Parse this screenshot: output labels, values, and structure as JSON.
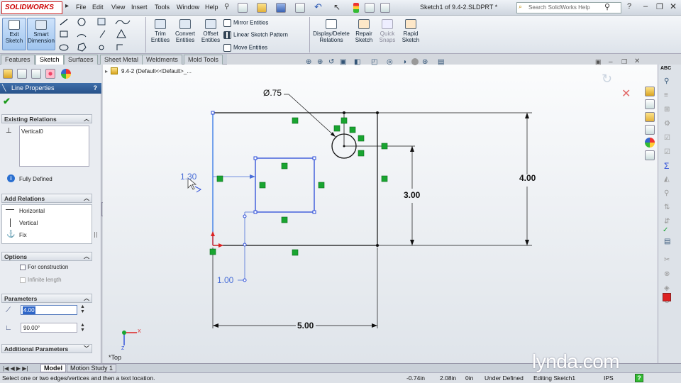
{
  "app": {
    "logo": "SOLIDWORKS",
    "doc_title": "Sketch1 of 9.4-2.SLDPRT *"
  },
  "menu": [
    "File",
    "Edit",
    "View",
    "Insert",
    "Tools",
    "Window",
    "Help"
  ],
  "search": {
    "placeholder": "Search SolidWorks Help"
  },
  "cmd": {
    "exit_sketch": "Exit Sketch",
    "smart_dimension": "Smart Dimension",
    "trim_entities": "Trim Entities",
    "convert_entities": "Convert Entities",
    "offset_entities": "Offset Entities",
    "mirror_entities": "Mirror Entities",
    "linear_pattern": "Linear Sketch Pattern",
    "move_entities": "Move Entities",
    "display_relations": "Display/Delete Relations",
    "repair_sketch": "Repair Sketch",
    "quick_snaps": "Quick Snaps",
    "rapid_sketch": "Rapid Sketch"
  },
  "tabs": [
    "Features",
    "Sketch",
    "Surfaces",
    "Sheet Metal",
    "Weldments",
    "Mold Tools"
  ],
  "tree_path": "9.4-2  (Default<<Default>_...",
  "pm": {
    "title": "Line Properties",
    "help": "?",
    "existing_relations": "Existing Relations",
    "relation_item": "Vertical0",
    "fully_defined": "Fully Defined",
    "add_relations": "Add Relations",
    "horizontal": "Horizontal",
    "vertical": "Vertical",
    "fix": "Fix",
    "options": "Options",
    "for_construction": "For construction",
    "infinite_length": "Infinite length",
    "parameters": "Parameters",
    "length_value": "4.00",
    "angle_value": "90.00°",
    "additional_parameters": "Additional Parameters"
  },
  "dims": {
    "dia": "Ø.75",
    "d4": "4.00",
    "d3": "3.00",
    "d5": "5.00",
    "d130": "1.30",
    "d100": "1.00"
  },
  "view_label": "*Top",
  "bottom_tabs": [
    "Model",
    "Motion Study 1"
  ],
  "status": {
    "message": "Select one or two edges/vertices and then a text location.",
    "x": "-0.74in",
    "y": "2.08in",
    "z": "0in",
    "state": "Under Defined",
    "editing": "Editing Sketch1",
    "units": "IPS"
  },
  "watermark": "lynda.com",
  "colors": {
    "sketch_blue": "#2a4bd8",
    "relation_green": "#19a530",
    "pm_title": "#2f5d98"
  }
}
